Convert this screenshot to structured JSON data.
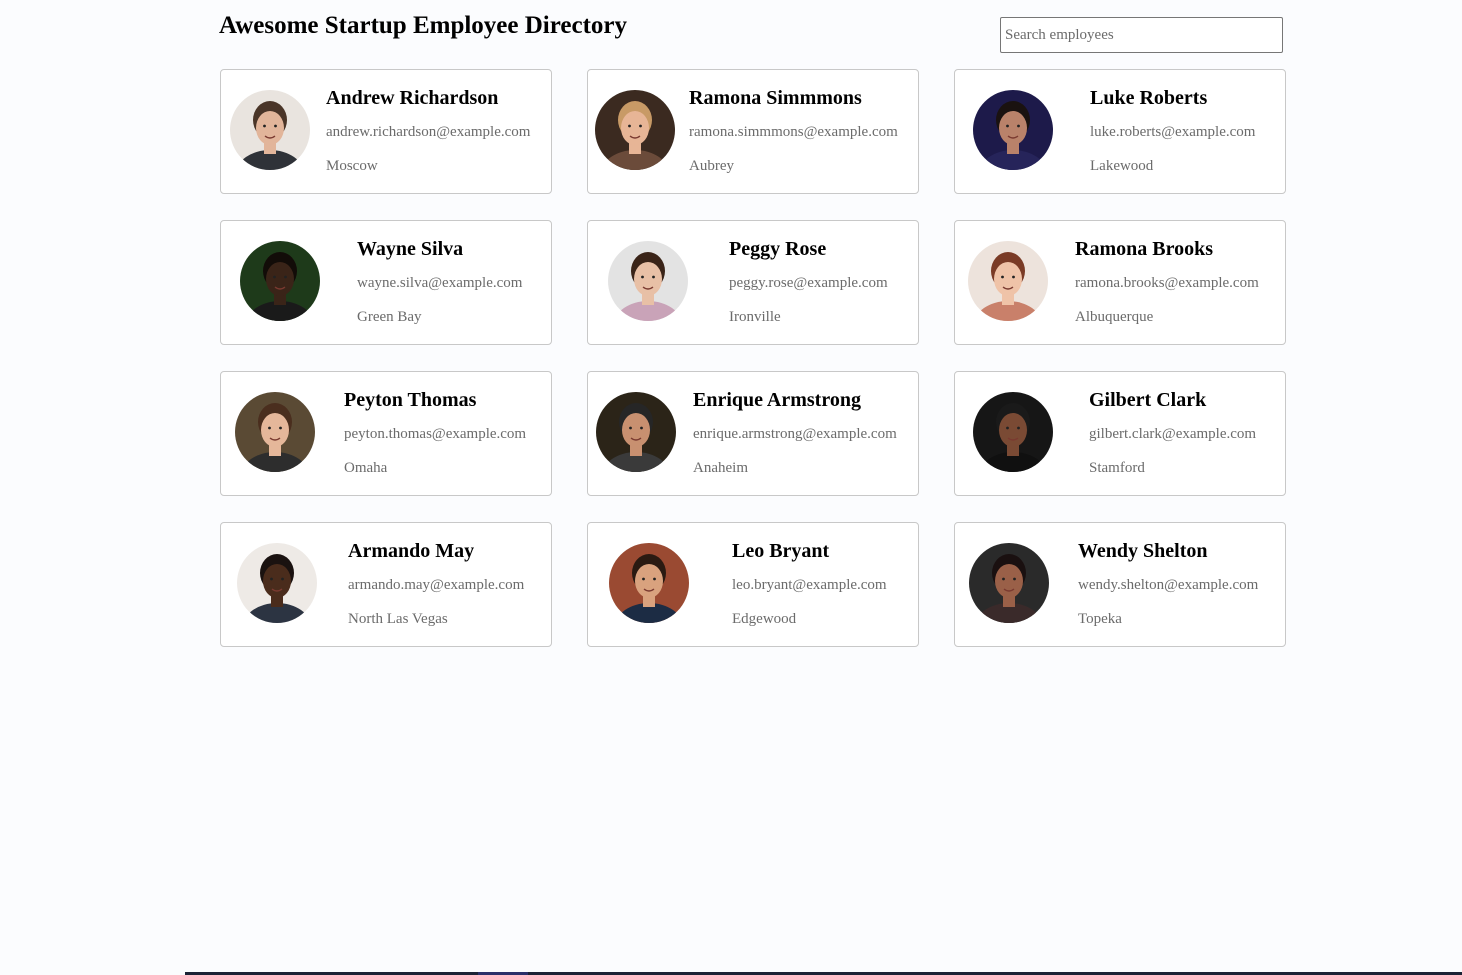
{
  "header": {
    "title": "Awesome Startup Employee Directory",
    "search_placeholder": "Search employees"
  },
  "employees": [
    {
      "name": "Andrew Richardson",
      "email": "andrew.richardson@example.com",
      "location": "Moscow",
      "avatar": {
        "bg": "#e9e4df",
        "skin": "#e2b59a",
        "hair": "#4a3528",
        "shirt": "#2f3238"
      }
    },
    {
      "name": "Ramona Simmmons",
      "email": "ramona.simmmons@example.com",
      "location": "Aubrey",
      "avatar": {
        "bg": "#3b2a20",
        "skin": "#e7b596",
        "hair": "#c89a66",
        "shirt": "#6b4b3a"
      }
    },
    {
      "name": "Luke Roberts",
      "email": "luke.roberts@example.com",
      "location": "Lakewood",
      "avatar": {
        "bg": "#1d1a4a",
        "skin": "#b9826a",
        "hair": "#1a1210",
        "shirt": "#26245a"
      }
    },
    {
      "name": "Wayne Silva",
      "email": "wayne.silva@example.com",
      "location": "Green Bay",
      "avatar": {
        "bg": "#1e3a1a",
        "skin": "#3a2418",
        "hair": "#120c08",
        "shirt": "#1a1a1a"
      }
    },
    {
      "name": "Peggy Rose",
      "email": "peggy.rose@example.com",
      "location": "Ironville",
      "avatar": {
        "bg": "#e3e3e3",
        "skin": "#e8c0a6",
        "hair": "#3a2418",
        "shirt": "#c9a3b8"
      }
    },
    {
      "name": "Ramona Brooks",
      "email": "ramona.brooks@example.com",
      "location": "Albuquerque",
      "avatar": {
        "bg": "#ede3dc",
        "skin": "#efc3a8",
        "hair": "#7a3b26",
        "shirt": "#c9806a"
      }
    },
    {
      "name": "Peyton Thomas",
      "email": "peyton.thomas@example.com",
      "location": "Omaha",
      "avatar": {
        "bg": "#5a4a34",
        "skin": "#e5b79a",
        "hair": "#4a2e1e",
        "shirt": "#2d2d2d"
      }
    },
    {
      "name": "Enrique Armstrong",
      "email": "enrique.armstrong@example.com",
      "location": "Anaheim",
      "avatar": {
        "bg": "#2b2418",
        "skin": "#c89070",
        "hair": "#262626",
        "shirt": "#3a3a3a"
      }
    },
    {
      "name": "Gilbert Clark",
      "email": "gilbert.clark@example.com",
      "location": "Stamford",
      "avatar": {
        "bg": "#161616",
        "skin": "#7a4a34",
        "hair": "#1a1a1a",
        "shirt": "#101010"
      }
    },
    {
      "name": "Armando May",
      "email": "armando.may@example.com",
      "location": "North Las Vegas",
      "avatar": {
        "bg": "#eeeae6",
        "skin": "#4a2c1c",
        "hair": "#1a1210",
        "shirt": "#2c3442"
      }
    },
    {
      "name": "Leo Bryant",
      "email": "leo.bryant@example.com",
      "location": "Edgewood",
      "avatar": {
        "bg": "#9a4a32",
        "skin": "#d9a27e",
        "hair": "#2a1a12",
        "shirt": "#1c2c44"
      }
    },
    {
      "name": "Wendy Shelton",
      "email": "wendy.shelton@example.com",
      "location": "Topeka",
      "avatar": {
        "bg": "#2a2a2a",
        "skin": "#9a6048",
        "hair": "#1a1010",
        "shirt": "#3a2a2a"
      }
    }
  ]
}
